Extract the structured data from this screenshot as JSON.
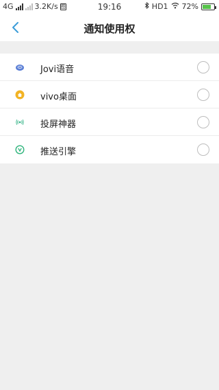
{
  "status_bar": {
    "network_type": "4G",
    "speed": "3.2K/s",
    "time": "19:16",
    "hd_label": "HD1",
    "battery_percent": "72%",
    "battery_level": 0.72,
    "battery_color": "#56c34b"
  },
  "header": {
    "title": "通知使用权",
    "back_icon": "chevron-left-icon",
    "accent_color": "#3a9cd8"
  },
  "apps": [
    {
      "label": "Jovi语音",
      "icon": "jovi-icon",
      "selected": false
    },
    {
      "label": "vivo桌面",
      "icon": "home-icon",
      "selected": false
    },
    {
      "label": "投屏神器",
      "icon": "cast-icon",
      "selected": false
    },
    {
      "label": "推送引擎",
      "icon": "push-engine-icon",
      "selected": false
    }
  ]
}
